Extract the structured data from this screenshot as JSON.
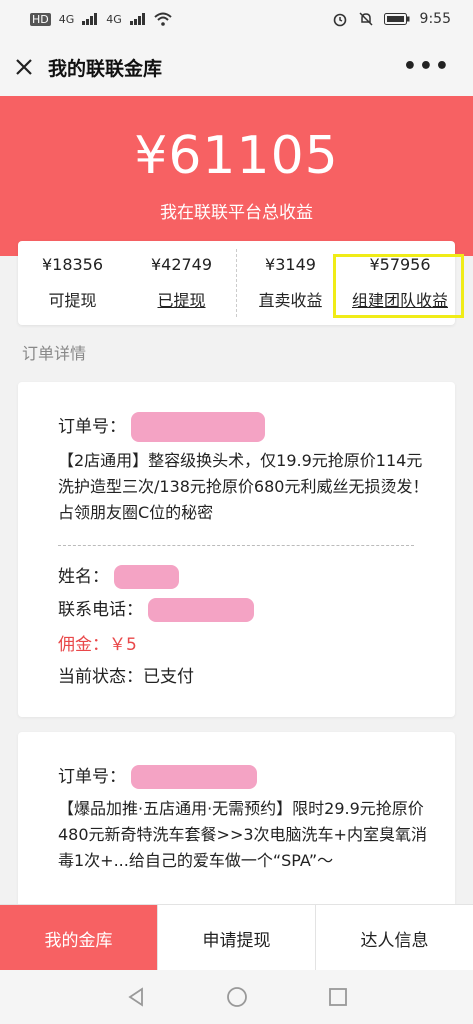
{
  "status": {
    "hd": "HD",
    "net1": "4G",
    "net2": "4G",
    "time": "9:55"
  },
  "nav": {
    "title": "我的联联金库"
  },
  "summary": {
    "total": "¥61105",
    "total_label": "我在联联平台总收益",
    "stats": [
      {
        "amount": "¥18356",
        "label": "可提现"
      },
      {
        "amount": "¥42749",
        "label": "已提现"
      },
      {
        "amount": "¥3149",
        "label": "直卖收益"
      },
      {
        "amount": "¥57956",
        "label": "组建团队收益"
      }
    ]
  },
  "section_title": "订单详情",
  "orders": [
    {
      "order_no_label": "订单号：",
      "desc": "【2店通用】整容级换头术，仅19.9元抢原价114元洗护造型三次/138元抢原价680元利威丝无损烫发！占领朋友圈C位的秘密",
      "name_label": "姓名：",
      "phone_label": "联系电话：",
      "commission": "佣金：￥5",
      "status": "当前状态：已支付"
    },
    {
      "order_no_label": "订单号：",
      "desc": "【爆品加推·五店通用·无需预约】限时29.9元抢原价480元新奇特洗车套餐>>3次电脑洗车+内室臭氧消毒1次+...给自己的爱车做一个“SPA”～"
    }
  ],
  "tabs": [
    "我的金库",
    "申请提现",
    "达人信息"
  ],
  "colors": {
    "accent": "#f76163",
    "highlight_box": "#f0ec17",
    "mask": "#f4a3c4"
  }
}
